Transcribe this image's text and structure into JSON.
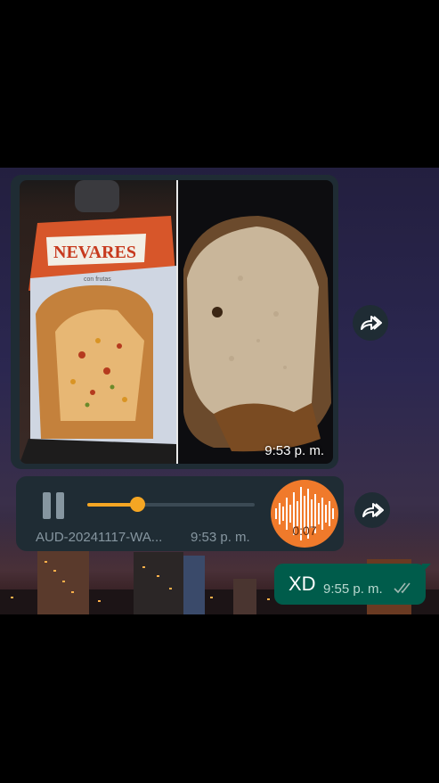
{
  "conversation": {
    "image_message": {
      "packaging_brand": "NEVARES",
      "packaging_subtitle": "con frutas",
      "time": "9:53 p. m."
    },
    "audio_message": {
      "filename": "AUD-20241117-WA...",
      "time": "9:53 p. m.",
      "duration": "0:07",
      "playback_progress": 0.3,
      "state_icon": "pause-icon"
    },
    "outgoing_message": {
      "text": "XD",
      "time": "9:55 p. m.",
      "status_icon": "double-check-icon"
    },
    "forward_icon": "forward-icon",
    "colors": {
      "accent": "#f5a623",
      "bubble_incoming": "#1f2c34",
      "bubble_outgoing": "#005c4b"
    }
  }
}
